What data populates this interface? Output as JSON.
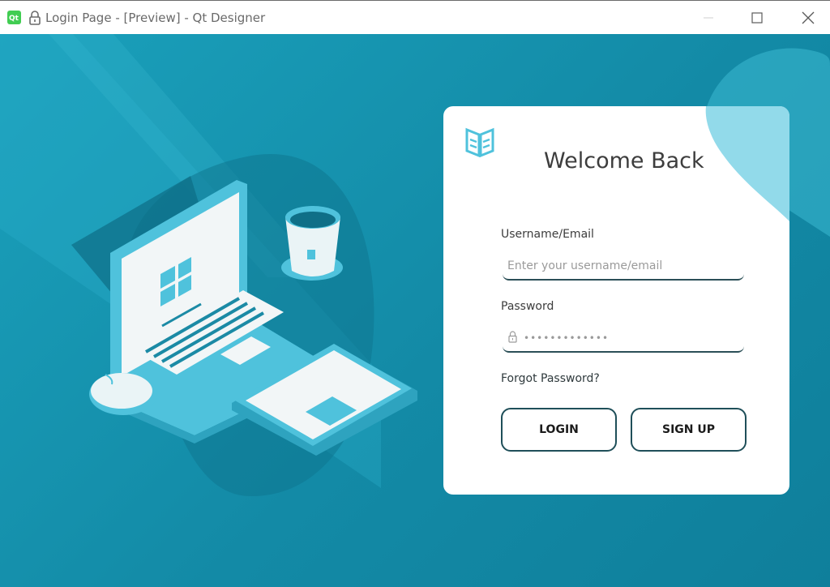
{
  "window": {
    "title": "Login Page - [Preview] - Qt Designer",
    "app_icon": "qt-designer-icon",
    "controls": [
      "minimize-icon",
      "maximize-icon",
      "close-icon"
    ]
  },
  "login": {
    "heading": "Welcome Back",
    "username_label": "Username/Email",
    "username_placeholder": "Enter your username/email",
    "password_label": "Password",
    "password_value": "•••••••••••••",
    "forgot_label": "Forgot Password?",
    "login_button": "LOGIN",
    "signup_button": "SIGN UP"
  },
  "colors": {
    "background": "#138aa6",
    "accent": "#5ec6de",
    "card": "#ffffff",
    "button_border": "#1f4f59"
  }
}
